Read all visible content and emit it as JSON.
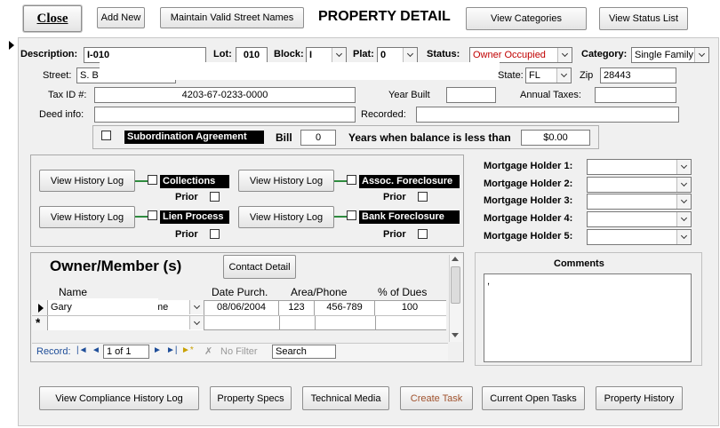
{
  "toolbar": {
    "close": "Close",
    "add_new": "Add New",
    "maintain_streets": "Maintain Valid Street Names",
    "title": "PROPERTY DETAIL",
    "view_categories": "View Categories",
    "view_status_list": "View Status List"
  },
  "property": {
    "description_label": "Description:",
    "description": "I-010",
    "lot_label": "Lot:",
    "lot": "010",
    "block_label": "Block:",
    "block": "I",
    "plat_label": "Plat:",
    "plat": "0",
    "status_label": "Status:",
    "status": "Owner Occupied",
    "category_label": "Category:",
    "category": "Single Family",
    "street_label": "Street:",
    "street": "S. B",
    "state_label": "State:",
    "state": "FL",
    "zip_label": "Zip",
    "zip": "28443",
    "taxid_label": "Tax ID #:",
    "taxid": "4203-67-0233-0000",
    "year_built_label": "Year Built",
    "year_built": "",
    "annual_taxes_label": "Annual Taxes:",
    "annual_taxes": "",
    "deed_label": "Deed info:",
    "deed": "",
    "recorded_label": "Recorded:",
    "recorded": ""
  },
  "subordination": {
    "label": "Subordination Agreement",
    "bill_label": "Bill",
    "bill": "0",
    "years_label": "Years when balance is less than",
    "amount": "$0.00"
  },
  "history": {
    "view_log": "View History Log",
    "collections": "Collections",
    "assoc_foreclosure": "Assoc. Foreclosure",
    "lien_process": "Lien Process",
    "bank_foreclosure": "Bank Foreclosure",
    "prior": "Prior"
  },
  "mortgage": {
    "h1": "Mortgage Holder 1:",
    "h2": "Mortgage Holder 2:",
    "h3": "Mortgage Holder 3:",
    "h4": "Mortgage Holder 4:",
    "h5": "Mortgage Holder 5:"
  },
  "owners": {
    "title": "Owner/Member (s)",
    "contact_detail": "Contact Detail",
    "col_name": "Name",
    "col_date": "Date Purch.",
    "col_area": "Area/Phone",
    "col_dues": "% of Dues",
    "row_name": "Gary",
    "row_name_suffix": "me",
    "row_date": "08/06/2004",
    "row_area": "123",
    "row_phone": "456-789",
    "row_dues": "100",
    "nav_record": "Record:",
    "nav_position": "1 of 1",
    "nav_filter": "No Filter",
    "nav_search": "Search"
  },
  "comments": {
    "label": "Comments",
    "text": ","
  },
  "bottom": {
    "compliance": "View Compliance History Log",
    "specs": "Property Specs",
    "technical": "Technical Media",
    "create_task": "Create  Task",
    "open_tasks": "Current Open Tasks",
    "history": "Property History"
  },
  "colors": {
    "status": "#c00000",
    "create_task": "#a0522d",
    "panel": "#f0f0f0",
    "dark_label": "#000000",
    "connector": "#2e8b3e"
  }
}
